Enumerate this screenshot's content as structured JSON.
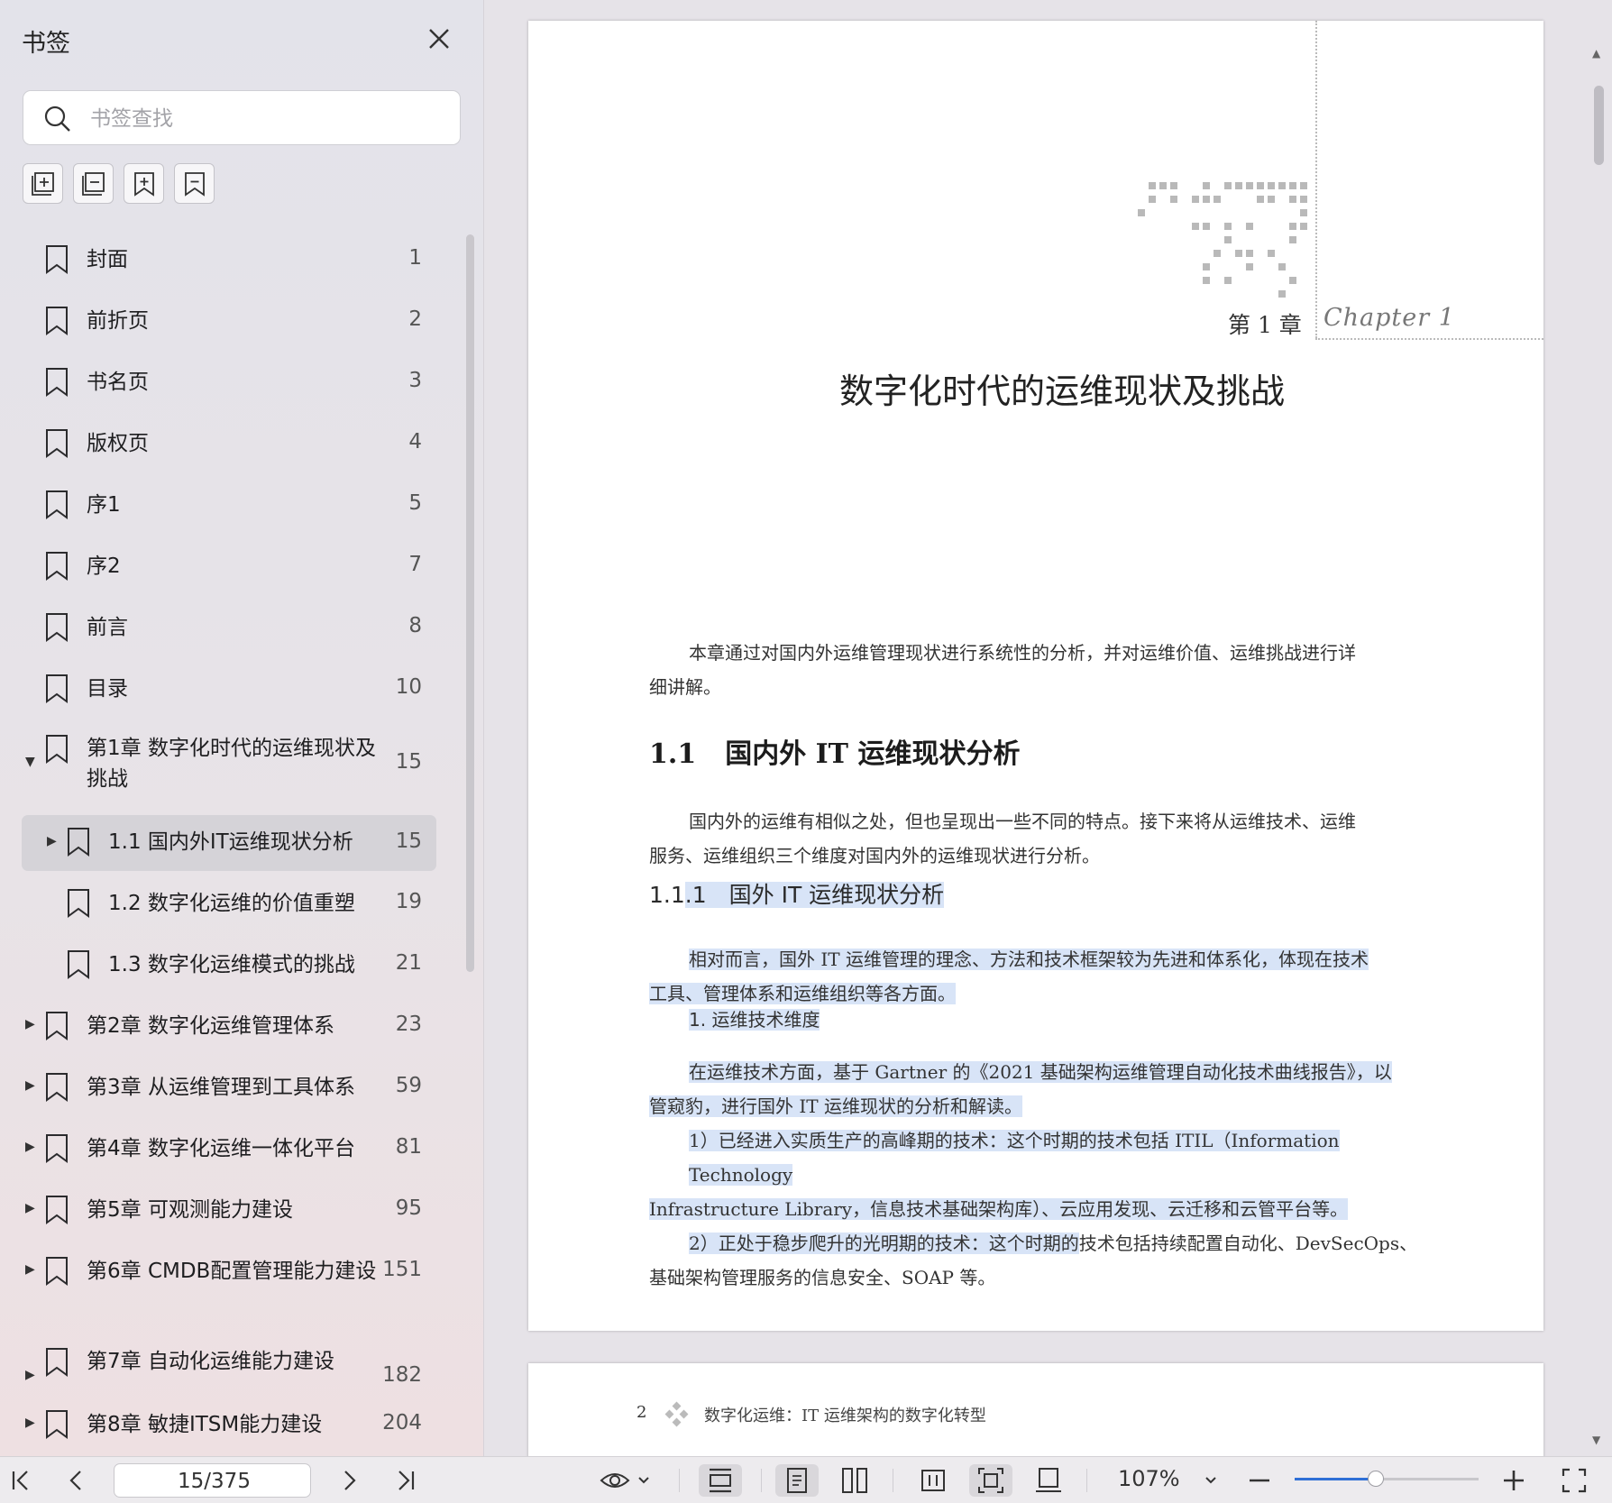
{
  "sidebar": {
    "title": "书签",
    "search_placeholder": "书签查找",
    "tools": [
      {
        "name": "expand-all-icon"
      },
      {
        "name": "collapse-all-icon"
      },
      {
        "name": "add-bookmark-icon"
      },
      {
        "name": "remove-bookmark-icon"
      }
    ],
    "items": [
      {
        "label": "封面",
        "page": "1"
      },
      {
        "label": "前折页",
        "page": "2"
      },
      {
        "label": "书名页",
        "page": "3"
      },
      {
        "label": "版权页",
        "page": "4"
      },
      {
        "label": "序1",
        "page": "5"
      },
      {
        "label": "序2",
        "page": "7"
      },
      {
        "label": "前言",
        "page": "8"
      },
      {
        "label": "目录",
        "page": "10"
      },
      {
        "label": "第1章 数字化时代的运维现状及挑战",
        "page": "15",
        "expanded": true
      },
      {
        "label": "1.1 国内外IT运维现状分析",
        "page": "15",
        "selected": true
      },
      {
        "label": "1.2 数字化运维的价值重塑",
        "page": "19"
      },
      {
        "label": "1.3 数字化运维模式的挑战",
        "page": "21"
      },
      {
        "label": "第2章 数字化运维管理体系",
        "page": "23"
      },
      {
        "label": "第3章 从运维管理到工具体系",
        "page": "59"
      },
      {
        "label": "第4章 数字化运维一体化平台",
        "page": "81"
      },
      {
        "label": "第5章 可观测能力建设",
        "page": "95"
      },
      {
        "label": "第6章 CMDB配置管理能力建设",
        "page": "151"
      },
      {
        "label": "第7章 自动化运维能力建设",
        "page": "182"
      },
      {
        "label": "第8章 敏捷ITSM能力建设",
        "page": "204"
      }
    ]
  },
  "document": {
    "page1": {
      "chapter_label": "第 1 章",
      "chapter_script": "Chapter 1",
      "chapter_title": "数字化时代的运维现状及挑战",
      "intro_line1": "本章通过对国内外运维管理现状进行系统性的分析，并对运维价值、运维挑战进行详",
      "intro_line2": "细讲解。",
      "h1_num": "1.1",
      "h1_text": "国内外 IT 运维现状分析",
      "p1_line1": "国内外的运维有相似之处，但也呈现出一些不同的特点。接下来将从运维技术、运维",
      "p1_line2": "服务、运维组织三个维度对国内外的运维现状进行分析。",
      "h2_pre": "1.1",
      "h2_post": ".1　国外 IT 运维现状分析",
      "p2_line1": "相对而言，国外 IT 运维管理的理念、方法和技术框架较为先进和体系化，体现在技术",
      "p2_line2": "工具、管理体系和运维组织等各方面。",
      "sub1": "1. 运维技术维度",
      "p3_line1": "在运维技术方面，基于 Gartner 的《2021 基础架构运维管理自动化技术曲线报告》，以",
      "p3_line2": "管窥豹，进行国外 IT 运维现状的分析和解读。",
      "p4_line1": "1）已经进入实质生产的高峰期的技术：这个时期的技术包括 ITIL（Information Technology",
      "p4_line2": "Infrastructure Library，信息技术基础架构库）、云应用发现、云迁移和云管平台等。",
      "p5_line1_hl": "2）正处于稳步爬升的光明期的技术：这个时期的",
      "p5_line1_rest": "技术包括持续配置自动化、DevSecOps、",
      "p5_line2": "基础架构管理服务的信息安全、SOAP 等。"
    },
    "page2": {
      "page_number": "2",
      "header_text": "数字化运维：IT 运维架构的数字化转型"
    }
  },
  "toolbar": {
    "page_value": "15/375",
    "zoom": "107%",
    "zoom_fraction": 0.44,
    "accent_color": "#2f6fd6"
  }
}
